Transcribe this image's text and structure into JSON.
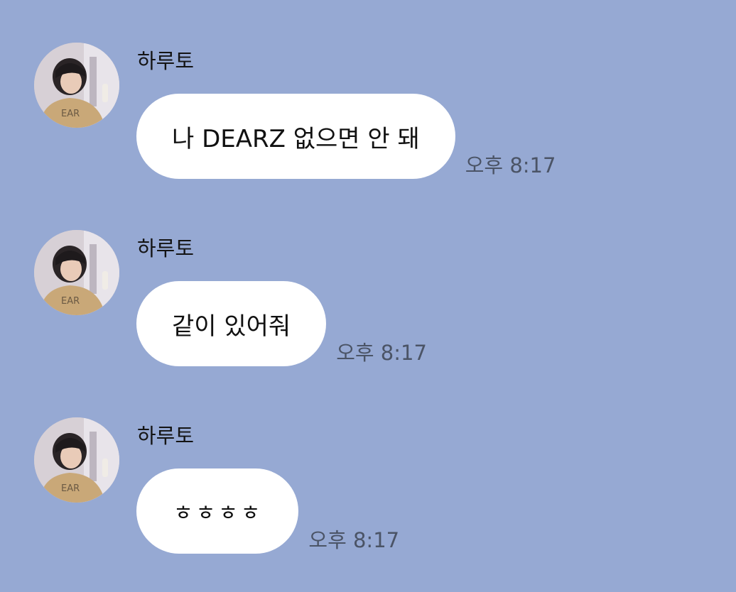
{
  "chat": {
    "messages": [
      {
        "sender": "하루토",
        "text": "나 DEARZ 없으면 안 돼",
        "time": "오후 8:17",
        "avatar_icon": "profile-photo"
      },
      {
        "sender": "하루토",
        "text": "같이 있어줘",
        "time": "오후 8:17",
        "avatar_icon": "profile-photo"
      },
      {
        "sender": "하루토",
        "text": "ㅎㅎㅎㅎ",
        "time": "오후 8:17",
        "avatar_icon": "profile-photo"
      }
    ]
  },
  "colors": {
    "background": "#96a9d3",
    "bubble": "#ffffff",
    "timestamp": "#4b5466"
  }
}
